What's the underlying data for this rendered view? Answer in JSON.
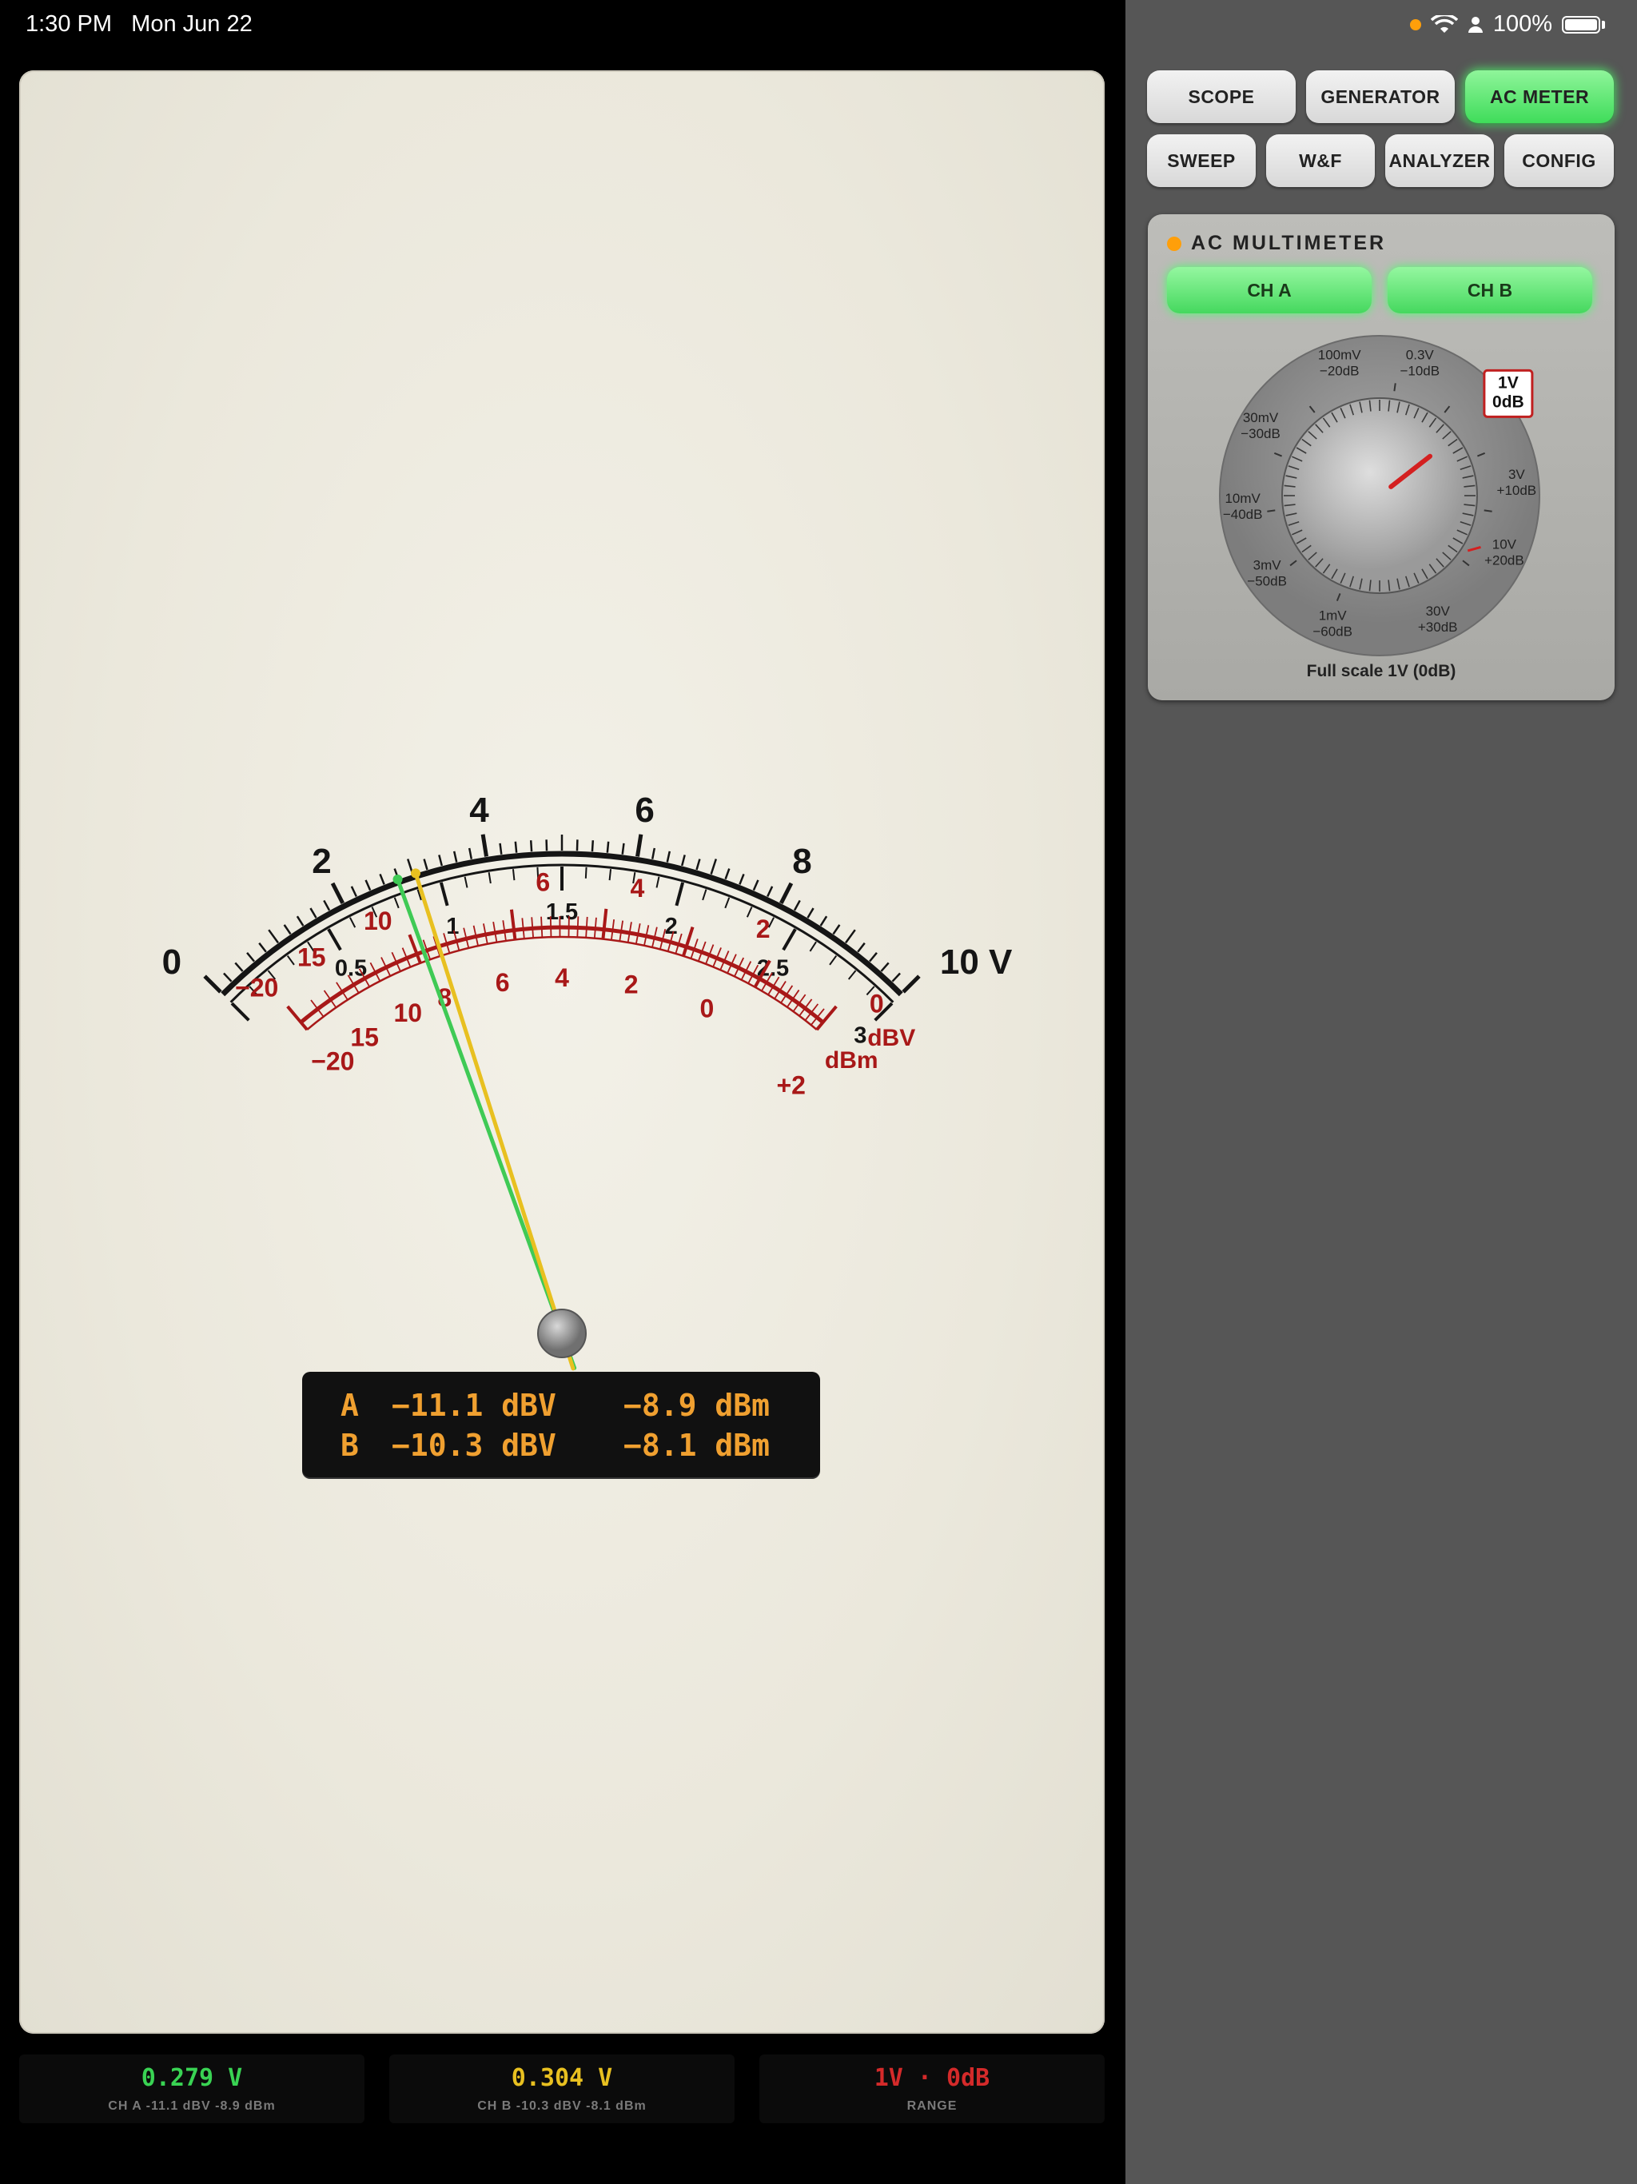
{
  "status": {
    "time": "1:30 PM",
    "date": "Mon Jun 22",
    "battery": "100%"
  },
  "meter": {
    "volt_major": [
      "0",
      "2",
      "4",
      "6",
      "8",
      "10 V"
    ],
    "volt_minor": [
      "0.5",
      "1",
      "1.5",
      "2",
      "2.5",
      "3"
    ],
    "dbv_top": [
      "−20",
      "15",
      "10",
      "6",
      "4",
      "2",
      "0"
    ],
    "dbv_unit": "dBV",
    "dbm_bottom": [
      "−20",
      "15",
      "10",
      "8",
      "6",
      "4",
      "2",
      "0",
      "+2"
    ],
    "dbm_unit": "dBm",
    "needle_a_fraction": 0.279,
    "needle_b_fraction": 0.304,
    "color_needle_a": "#3fca55",
    "color_needle_b": "#e8c020"
  },
  "readout": {
    "a": {
      "ch": "A",
      "dbv": "−11.1 dBV",
      "dbm": "−8.9 dBm"
    },
    "b": {
      "ch": "B",
      "dbv": "−10.3 dBV",
      "dbm": "−8.1 dBm"
    }
  },
  "tabs": {
    "scope": "SCOPE",
    "generator": "GENERATOR",
    "ac_meter": "AC METER",
    "sweep": "SWEEP",
    "wf": "W&F",
    "analyzer": "ANALYZER",
    "config": "CONFIG"
  },
  "ac_panel": {
    "title": "AC MULTIMETER",
    "ch_a": "CH A",
    "ch_b": "CH B",
    "ranges": [
      {
        "v": "1mV",
        "db": "−60dB"
      },
      {
        "v": "3mV",
        "db": "−50dB"
      },
      {
        "v": "10mV",
        "db": "−40dB"
      },
      {
        "v": "30mV",
        "db": "−30dB"
      },
      {
        "v": "100mV",
        "db": "−20dB"
      },
      {
        "v": "0.3V",
        "db": "−10dB"
      },
      {
        "v": "1V",
        "db": "0dB"
      },
      {
        "v": "3V",
        "db": "+10dB"
      },
      {
        "v": "10V",
        "db": "+20dB"
      },
      {
        "v": "30V",
        "db": "+30dB"
      }
    ],
    "selected_range": "1V",
    "full_scale": "Full scale 1V  (0dB)"
  },
  "bottom": {
    "ch_a": {
      "value": "0.279 V",
      "label": "CH A  -11.1 dBV  -8.9 dBm",
      "color": "#39d353"
    },
    "ch_b": {
      "value": "0.304 V",
      "label": "CH B  -10.3 dBV  -8.1 dBm",
      "color": "#e8c020"
    },
    "range": {
      "value": "1V  ·  0dB",
      "label": "RANGE",
      "color": "#d42a2a"
    }
  }
}
